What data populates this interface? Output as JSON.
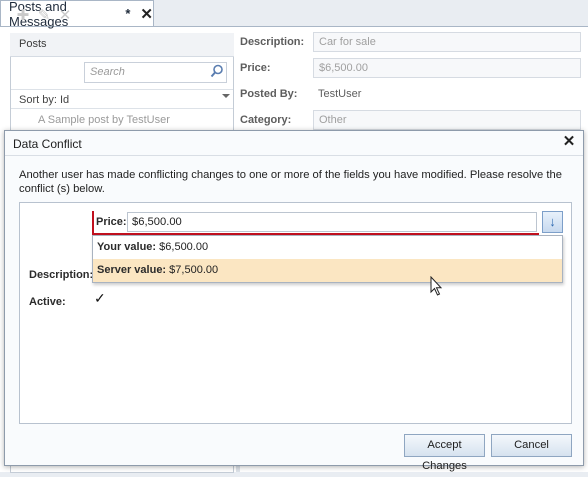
{
  "document_tab": {
    "title": "Posts and Messages",
    "modified_marker": "*",
    "close_glyph": "✕"
  },
  "posts_panel": {
    "header": "Posts",
    "search_placeholder": "Search",
    "sort_by": "Sort by: Id",
    "items": [
      "A Sample post by TestUser"
    ]
  },
  "post_details": {
    "description_label": "Description:",
    "description_value": "Car for sale",
    "price_label": "Price:",
    "price_value": "$6,500.00",
    "posted_by_label": "Posted By:",
    "posted_by_value": "TestUser",
    "category_label": "Category:",
    "category_value": "Other"
  },
  "dialog": {
    "title": "Data Conflict",
    "close_glyph": "✕",
    "message": "Another user has made conflicting changes to one or more of the fields you have modified.  Please resolve the conflict (s) below.",
    "price_label": "Price:",
    "price_value": "$6,500.00",
    "resolve_icon": "↓",
    "options": [
      {
        "label": "Your value:",
        "value": "$6,500.00"
      },
      {
        "label": "Server value:",
        "value": "$7,500.00"
      }
    ],
    "description_label": "Description:",
    "active_label": "Active:",
    "active_checked": "✓",
    "accept_button": "Accept Changes",
    "cancel_button": "Cancel"
  },
  "colors": {
    "conflict_red": "#c0101e",
    "hover_highlight": "#fbe6c2",
    "accent_blue": "#2f6ab1"
  }
}
